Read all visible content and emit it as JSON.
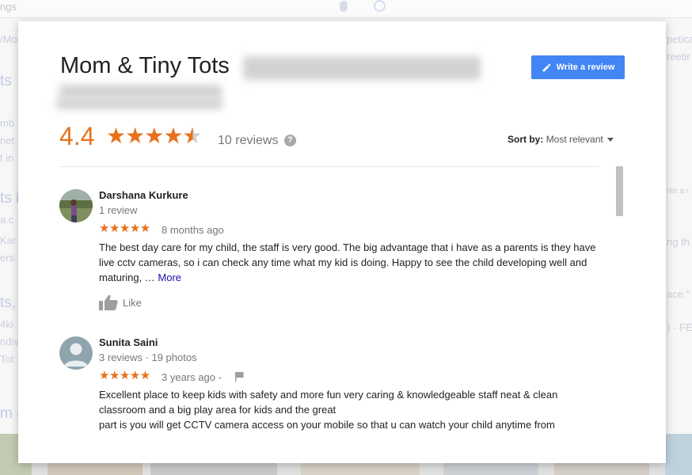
{
  "background": {
    "search_text": "ngs"
  },
  "modal": {
    "title": "Mom & Tiny Tots",
    "write_review_label": "Write a review",
    "rating": "4.4",
    "reviews_count": "10 reviews",
    "help_glyph": "?",
    "sort_label": "Sort by:",
    "sort_value": "Most relevant",
    "colors": {
      "accent": "#e7711b",
      "button": "#4285f4",
      "link": "#1a0dab"
    }
  },
  "reviews": [
    {
      "name": "Darshana Kurkure",
      "meta": "1 review",
      "stars": "★★★★★",
      "time": "8 months ago",
      "text": "The best day care for my child, the staff is very good. The big advantage that i have as a parents is they have live cctv cameras, so i can check any time what my kid is doing.  Happy to see the child developing well and maturing, … ",
      "more": "More",
      "like": "Like"
    },
    {
      "name": "Sunita Saini",
      "meta": "3 reviews · 19 photos",
      "stars": "★★★★★",
      "time": "3 years ago -",
      "text_lines": [
        "Excellent place to keep kids with safety and more fun very caring & knowledgeable staff neat & clean",
        "classroom and a big play area for kids and the great",
        "part is you will get CCTV camera access on your mobile so that u can watch your child anytime from"
      ]
    }
  ],
  "icons": [
    "pencil-icon",
    "help-icon",
    "chevron-down-icon",
    "thumbs-up-icon",
    "flag-icon",
    "star-icon",
    "avatar-icon"
  ]
}
